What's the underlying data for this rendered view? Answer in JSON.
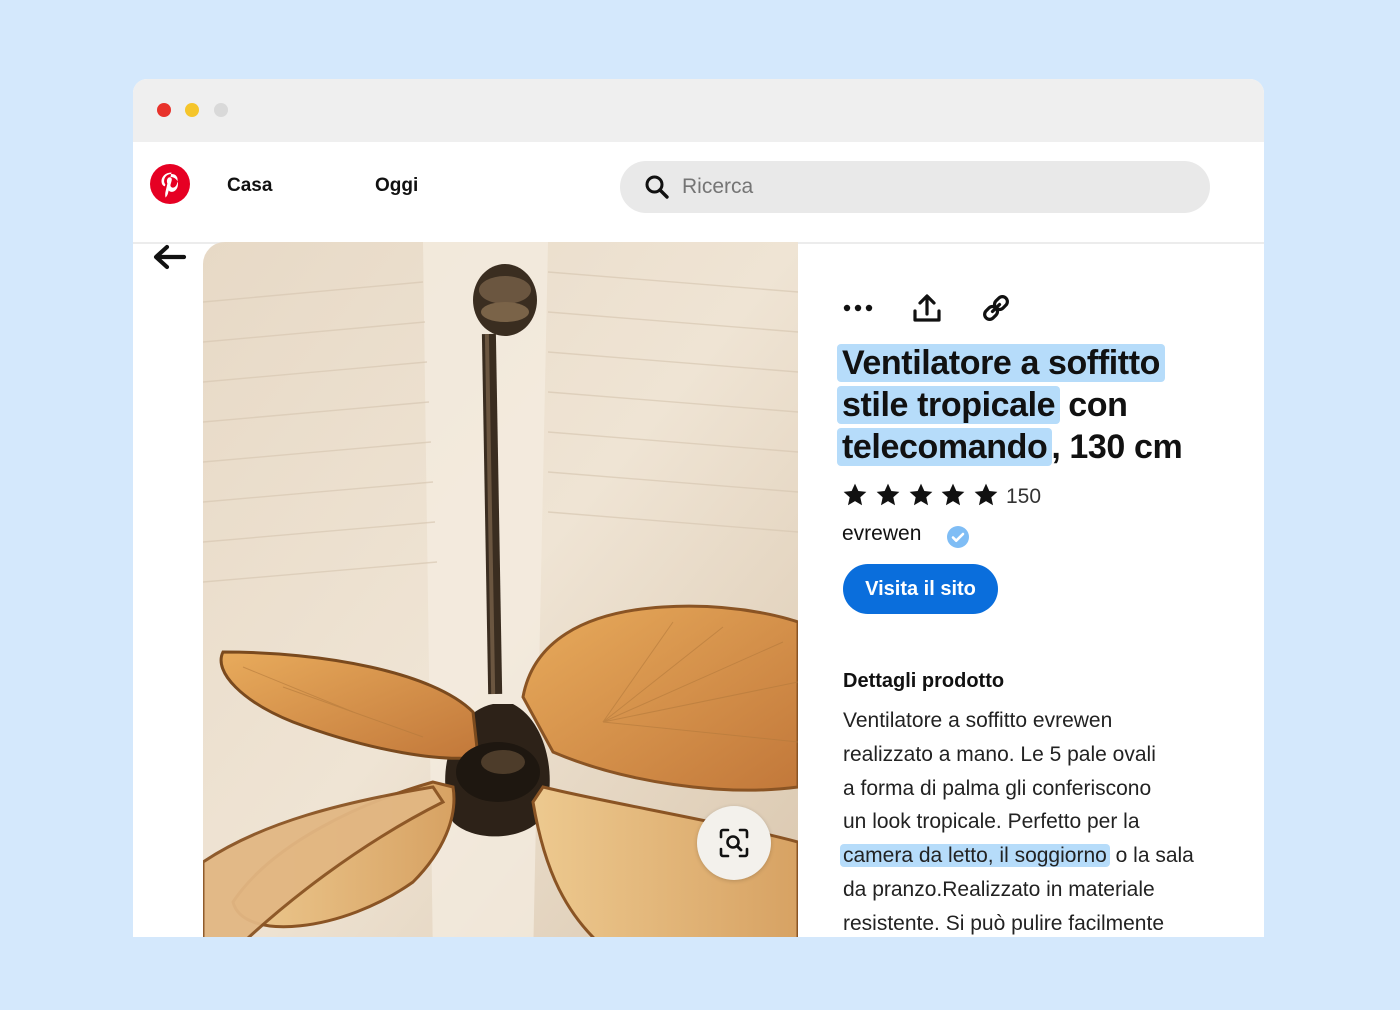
{
  "nav": {
    "links": [
      "Casa",
      "Oggi"
    ],
    "search_placeholder": "Ricerca"
  },
  "actions": [
    "more-icon",
    "share-icon",
    "link-icon"
  ],
  "product": {
    "title_hl1": "Ventilatore a soffitto",
    "title_hl2": "stile tropicale",
    "title_plain2": " con",
    "title_hl3": "telecomando",
    "title_plain3": ", 130 cm",
    "rating": 5,
    "rating_count": "150",
    "author": "evrewen",
    "visit_label": "Visita il sito"
  },
  "details": {
    "title": "Dettagli prodotto",
    "lines": [
      "Ventilatore a soffitto evrewen",
      "realizzato a mano. Le 5 pale ovali",
      "a forma di palma gli conferiscono",
      "un look tropicale. Perfetto per la"
    ],
    "hl_line": "camera da letto, il soggiorno",
    "hl_line_rest": " o la sala",
    "lines2": [
      "da pranzo.Realizzato in materiale",
      "resistente. Si può pulire facilmente"
    ]
  },
  "colors": {
    "background": "#d4e8fc",
    "pinterest_red": "#e60023",
    "visit_button": "#0a6edc",
    "highlight": "#b6dcfa"
  }
}
